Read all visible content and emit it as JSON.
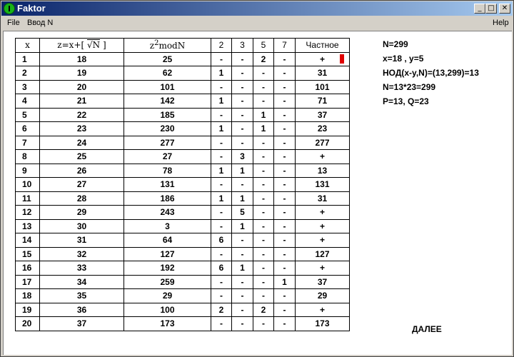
{
  "window": {
    "title": "Faktor",
    "min": "_",
    "max": "□",
    "close": "✕"
  },
  "menu": {
    "file": "File",
    "input": "Ввод N",
    "help": "Help"
  },
  "table": {
    "headers": {
      "x": "x",
      "z_prefix": "z=x+[",
      "z_root": "√N",
      "z_suffix": "]",
      "mod_base": "z",
      "mod_exp": "2",
      "mod_tail": "modN",
      "d2": "2",
      "d3": "3",
      "d5": "5",
      "d7": "7",
      "quotient": "Частное"
    },
    "rows": [
      [
        "1",
        "18",
        "25",
        "-",
        "-",
        "2",
        "-",
        "+"
      ],
      [
        "2",
        "19",
        "62",
        "1",
        "-",
        "-",
        "-",
        "31"
      ],
      [
        "3",
        "20",
        "101",
        "-",
        "-",
        "-",
        "-",
        "101"
      ],
      [
        "4",
        "21",
        "142",
        "1",
        "-",
        "-",
        "-",
        "71"
      ],
      [
        "5",
        "22",
        "185",
        "-",
        "-",
        "1",
        "-",
        "37"
      ],
      [
        "6",
        "23",
        "230",
        "1",
        "-",
        "1",
        "-",
        "23"
      ],
      [
        "7",
        "24",
        "277",
        "-",
        "-",
        "-",
        "-",
        "277"
      ],
      [
        "8",
        "25",
        "27",
        "-",
        "3",
        "-",
        "-",
        "+"
      ],
      [
        "9",
        "26",
        "78",
        "1",
        "1",
        "-",
        "-",
        "13"
      ],
      [
        "10",
        "27",
        "131",
        "-",
        "-",
        "-",
        "-",
        "131"
      ],
      [
        "11",
        "28",
        "186",
        "1",
        "1",
        "-",
        "-",
        "31"
      ],
      [
        "12",
        "29",
        "243",
        "-",
        "5",
        "-",
        "-",
        "+"
      ],
      [
        "13",
        "30",
        "3",
        "-",
        "1",
        "-",
        "-",
        "+"
      ],
      [
        "14",
        "31",
        "64",
        "6",
        "-",
        "-",
        "-",
        "+"
      ],
      [
        "15",
        "32",
        "127",
        "-",
        "-",
        "-",
        "-",
        "127"
      ],
      [
        "16",
        "33",
        "192",
        "6",
        "1",
        "-",
        "-",
        "+"
      ],
      [
        "17",
        "34",
        "259",
        "-",
        "-",
        "-",
        "1",
        "37"
      ],
      [
        "18",
        "35",
        "29",
        "-",
        "-",
        "-",
        "-",
        "29"
      ],
      [
        "19",
        "36",
        "100",
        "2",
        "-",
        "2",
        "-",
        "+"
      ],
      [
        "20",
        "37",
        "173",
        "-",
        "-",
        "-",
        "-",
        "173"
      ]
    ]
  },
  "info": {
    "n": "N=299",
    "xy": "x=18 , y=5",
    "gcd": "НОД(x-y,N)=(13,299)=13",
    "product": "N=13*23=299",
    "pq": "P=13, Q=23"
  },
  "next_label": "ДАЛЕЕ",
  "colors": {
    "marker": "#e00000",
    "plus": "#1010c0",
    "title_start": "#0a246a",
    "title_end": "#a6caf0"
  }
}
